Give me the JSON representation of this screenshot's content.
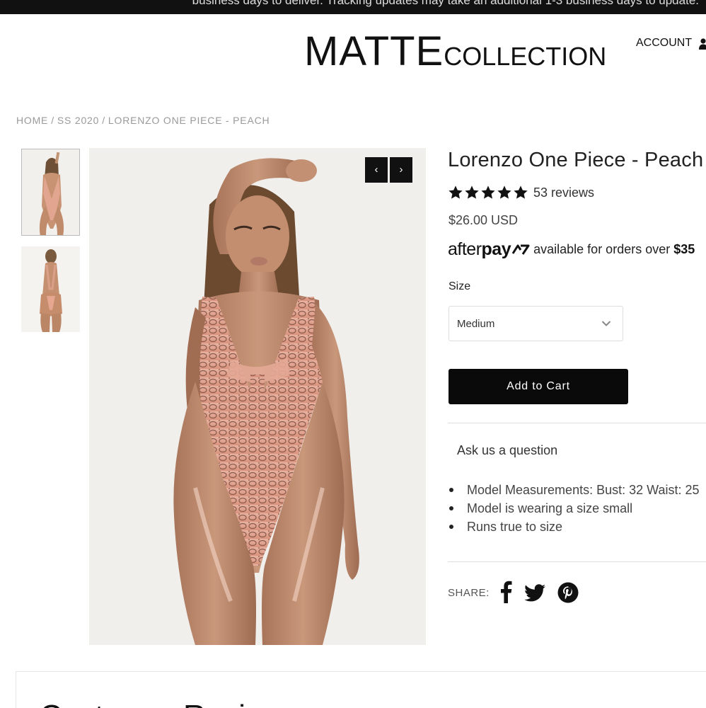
{
  "announcement": "business days to deliver. Tracking updates may take an additional 1-3 business days to update.",
  "header": {
    "logo_main": "MATTE",
    "logo_sub": "COLLECTION",
    "account_label": "ACCOUNT"
  },
  "breadcrumb": {
    "items": [
      "HOME",
      "SS 2020",
      "LORENZO ONE PIECE - PEACH"
    ],
    "separator": "/"
  },
  "gallery": {
    "thumbnails": [
      "front-view",
      "back-view"
    ],
    "prev_icon": "‹",
    "next_icon": "›"
  },
  "product": {
    "title": "Lorenzo One Piece - Peach",
    "rating_stars": 5,
    "reviews_label": "53 reviews",
    "price": "$26.00 USD",
    "afterpay_brand_pre": "after",
    "afterpay_brand_bold": "pay",
    "afterpay_text": "available for orders over",
    "afterpay_amount": "$35",
    "size_label": "Size",
    "size_selected": "Medium",
    "add_to_cart": "Add to Cart",
    "ask_question": "Ask us a question",
    "details": [
      "Model Measurements: Bust: 32 Waist: 25",
      "Model is wearing a size small",
      "Runs true to size"
    ],
    "share_label": "SHARE:"
  },
  "reviews_section": {
    "title": "Customer Reviews"
  },
  "colors": {
    "button_bg": "#0a0a0a",
    "announcement_bg": "#111111",
    "breadcrumb_text": "#9a9a9a",
    "afterpay_accent": "#111111"
  }
}
